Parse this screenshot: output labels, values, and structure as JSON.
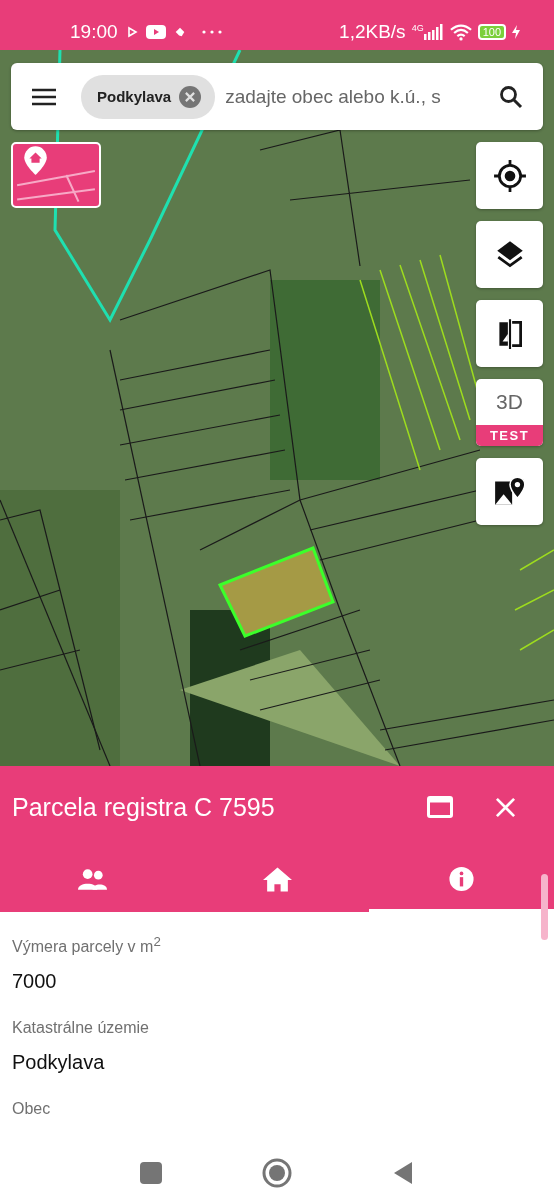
{
  "status_bar": {
    "time": "19:00",
    "network_speed": "1,2KB/s",
    "network_type": "4G",
    "battery": "100"
  },
  "search": {
    "chip": "Podkylava",
    "placeholder": "zadajte obec alebo k.ú., s"
  },
  "map_buttons": [
    {
      "kind": "locate"
    },
    {
      "kind": "layers"
    },
    {
      "kind": "compare"
    },
    {
      "kind": "threed",
      "label": "3D",
      "badge": "TEST"
    },
    {
      "kind": "maps"
    }
  ],
  "panel": {
    "title": "Parcela registra C 7595",
    "tabs": [
      {
        "kind": "owners",
        "selected": false
      },
      {
        "kind": "home",
        "selected": false
      },
      {
        "kind": "info",
        "selected": true
      }
    ],
    "fields": [
      {
        "label": "Výmera parcely v m$^{2}$",
        "value": "7000"
      },
      {
        "label": "Katastrálne územie",
        "value": "Podkylava"
      },
      {
        "label": "Obec"
      }
    ]
  }
}
